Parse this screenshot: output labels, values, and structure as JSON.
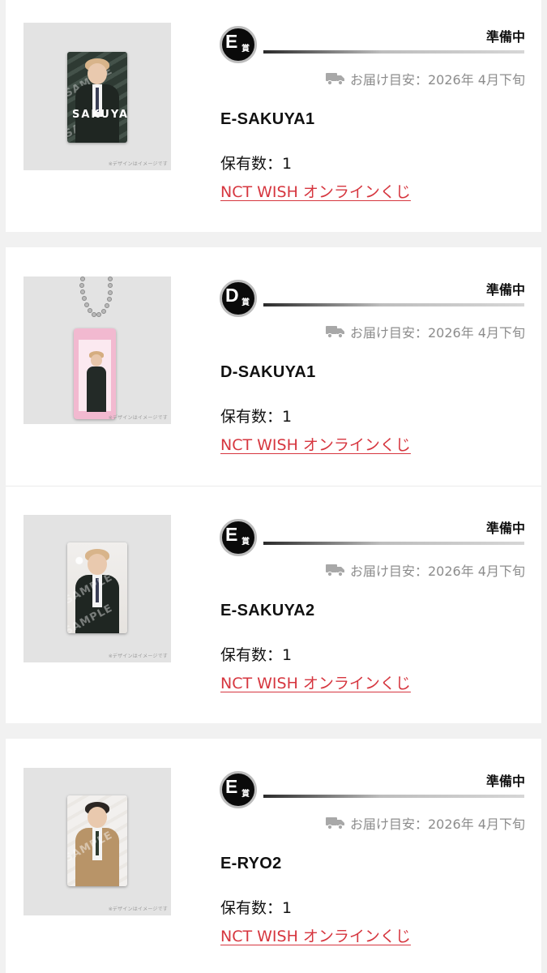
{
  "items": [
    {
      "prize_letter": "E",
      "prize_suffix": "賞",
      "status": "準備中",
      "delivery": "お届け目安：2026年 4月下旬",
      "name": "E-SAKUYA1",
      "holding": "保有数：1",
      "link": "NCT WISH オンラインくじ",
      "image_note": "※デザインはイメージです",
      "card_text": "SAKUYA"
    },
    {
      "prize_letter": "D",
      "prize_suffix": "賞",
      "status": "準備中",
      "delivery": "お届け目安：2026年 4月下旬",
      "name": "D-SAKUYA1",
      "holding": "保有数：1",
      "link": "NCT WISH オンラインくじ",
      "image_note": "※デザインはイメージです"
    },
    {
      "prize_letter": "E",
      "prize_suffix": "賞",
      "status": "準備中",
      "delivery": "お届け目安：2026年 4月下旬",
      "name": "E-SAKUYA2",
      "holding": "保有数：1",
      "link": "NCT WISH オンラインくじ",
      "image_note": "※デザインはイメージです"
    },
    {
      "prize_letter": "E",
      "prize_suffix": "賞",
      "status": "準備中",
      "delivery": "お届け目安：2026年 4月下旬",
      "name": "E-RYO2",
      "holding": "保有数：1",
      "link": "NCT WISH オンラインくじ",
      "image_note": "※デザインはイメージです"
    }
  ],
  "colors": {
    "background": "#f1f1f1",
    "card": "#ffffff",
    "link": "#d6363f",
    "muted": "#8c8c8c",
    "badge": "#0a0a0a"
  },
  "icons": [
    "truck-icon",
    "prize-badge-icon"
  ]
}
